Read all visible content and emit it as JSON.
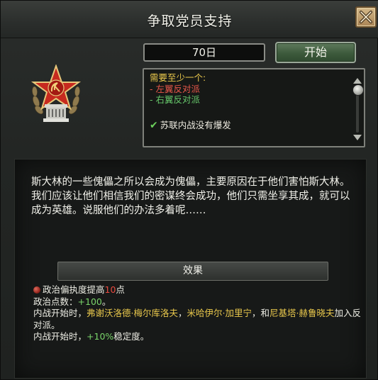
{
  "window": {
    "title": "争取党员支持",
    "close_icon": "close-x-icon"
  },
  "decision": {
    "duration": "70日",
    "start_label": "开始",
    "emblem_icon": "communist-star-emblem-icon"
  },
  "requirements": {
    "header": "需要至少一个:",
    "options": [
      {
        "text": "- 左翼反对派",
        "color": "#e8574a"
      },
      {
        "text": "- 右翼反对派",
        "color": "#66c76a"
      }
    ],
    "condition_icon": "checkmark-icon",
    "condition": "苏联内战没有爆发"
  },
  "description": "斯大林的一些傀儡之所以会成为傀儡，主要原因在于他们害怕斯大林。我们应该让他们相信我们的密谋终会成功，他们只需坐享其成，就可以成为英雄。说服他们的办法多着呢……",
  "effects": {
    "header": "效果",
    "line1_icon": "paranoia-bomb-icon",
    "line1_prefix": "政治偏执度提高",
    "line1_value": "10",
    "line1_suffix": "点",
    "line2_prefix": "政治点数：",
    "line2_value": "+100",
    "line2_suffix": "。",
    "line3_prefix": "内战开始时，",
    "line3_name1": "弗谢沃洛德·梅尔库洛夫",
    "line3_sep1": "，",
    "line3_name2": "米哈伊尔·加里宁",
    "line3_sep2": "，和",
    "line3_name3": "尼基塔·赫鲁晓夫",
    "line3_suffix": "加入反对派。",
    "line4_prefix": "内战开始时，",
    "line4_value": "+10%",
    "line4_suffix": "稳定度。"
  }
}
